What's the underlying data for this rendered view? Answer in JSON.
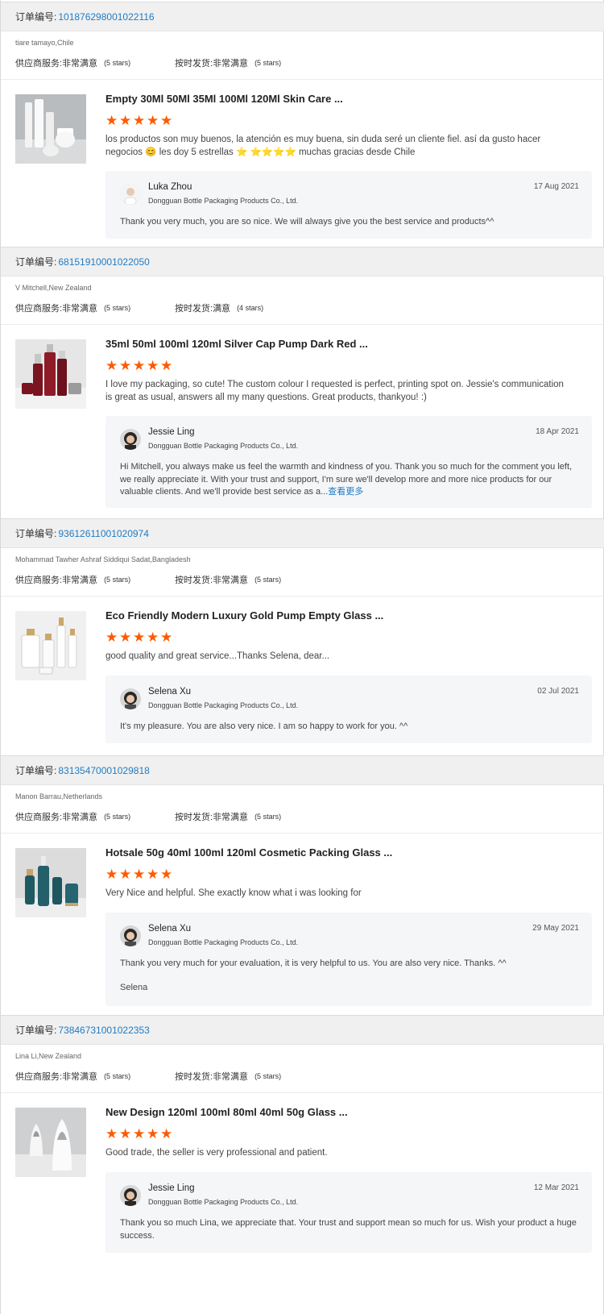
{
  "reviews": [
    {
      "order_label": "订单编号:",
      "order_no": "10187629800102211​6",
      "buyer": "tiare tamayo,Chile",
      "service_label": "供应商服务:",
      "service_value": "非常满意",
      "service_stars": "(5 stars)",
      "ship_label": "按时发货:",
      "ship_value": "非常满意",
      "ship_stars": "(5 stars)",
      "title": "Empty 30Ml 50Ml 35Ml 100Ml 120Ml Skin Care ...",
      "rating": 5,
      "comment": "los productos son muy buenos, la atención es muy buena, sin duda seré un cliente fiel. así da gusto hacer negocios 😊 les doy 5 estrellas ⭐ ⭐⭐⭐⭐ muchas gracias desde Chile",
      "reply_name": "Luka Zhou",
      "reply_company": "Dongguan Bottle Packaging Products Co., Ltd.",
      "reply_date": "17 Aug 2021",
      "reply_text": "Thank you very much,  you are so nice. We will always give you the best service and products^^",
      "reply_more": "",
      "reply_sig": ""
    },
    {
      "order_label": "订单编号:",
      "order_no": "68151910001022050",
      "buyer": "V Mitchell,New Zealand",
      "service_label": "供应商服务:",
      "service_value": "非常满意",
      "service_stars": "(5 stars)",
      "ship_label": "按时发货:",
      "ship_value": "满意",
      "ship_stars": "(4 stars)",
      "title": "35ml 50ml 100ml 120ml Silver Cap Pump Dark Red ...",
      "rating": 5,
      "comment": "I love my packaging, so cute! The custom colour I requested is perfect, printing spot on. Jessie's communication is great as usual, answers all my many questions. Great products, thankyou! :)",
      "reply_name": "Jessie Ling",
      "reply_company": "Dongguan Bottle Packaging Products Co., Ltd.",
      "reply_date": "18 Apr 2021",
      "reply_text": "Hi Mitchell, you always make us feel the warmth and kindness of you. Thank you so much for the comment you left, we really appreciate it. With your trust and support, I'm sure we'll develop more and more nice products for our valuable clients. And we'll  provide best service as a...",
      "reply_more": "查看更多",
      "reply_sig": ""
    },
    {
      "order_label": "订单编号:",
      "order_no": "93612611001020974",
      "buyer": "Mohammad Tawher Ashraf Siddiqui Sadat,Bangladesh",
      "service_label": "供应商服务:",
      "service_value": "非常满意",
      "service_stars": "(5 stars)",
      "ship_label": "按时发货:",
      "ship_value": "非常满意",
      "ship_stars": "(5 stars)",
      "title": "Eco Friendly Modern Luxury Gold Pump Empty Glass ...",
      "rating": 5,
      "comment": "good quality and great service...Thanks Selena, dear...",
      "reply_name": "Selena Xu",
      "reply_company": "Dongguan Bottle Packaging Products Co., Ltd.",
      "reply_date": "02 Jul 2021",
      "reply_text": "It's my pleasure. You are also very nice. I am so happy to work for you. ^^",
      "reply_more": "",
      "reply_sig": ""
    },
    {
      "order_label": "订单编号:",
      "order_no": "83135470001029818",
      "buyer": "Manon Barrau,Netherlands",
      "service_label": "供应商服务:",
      "service_value": "非常满意",
      "service_stars": "(5 stars)",
      "ship_label": "按时发货:",
      "ship_value": "非常满意",
      "ship_stars": "(5 stars)",
      "title": "Hotsale 50g 40ml 100ml 120ml Cosmetic Packing Glass ...",
      "rating": 5,
      "comment": "Very Nice and helpful. She exactly know what i was looking for",
      "reply_name": "Selena Xu",
      "reply_company": "Dongguan Bottle Packaging Products Co., Ltd.",
      "reply_date": "29 May 2021",
      "reply_text": "Thank you very much for your evaluation, it is very helpful to us. You are also very nice. Thanks. ^^",
      "reply_more": "",
      "reply_sig": "Selena"
    },
    {
      "order_label": "订单编号:",
      "order_no": "73846731001022353",
      "buyer": "Lina Li,New Zealand",
      "service_label": "供应商服务:",
      "service_value": "非常满意",
      "service_stars": "(5 stars)",
      "ship_label": "按时发货:",
      "ship_value": "非常满意",
      "ship_stars": "(5 stars)",
      "title": "New Design 120ml 100ml 80ml 40ml 50g Glass ...",
      "rating": 5,
      "comment": "Good trade, the seller is very professional and patient.",
      "reply_name": "Jessie Ling",
      "reply_company": "Dongguan Bottle Packaging Products Co., Ltd.",
      "reply_date": "12 Mar 2021",
      "reply_text": "Thank you so much Lina, we appreciate that. Your trust and support mean so much for us. Wish your product a huge success.",
      "reply_more": "",
      "reply_sig": ""
    }
  ],
  "colors": {
    "star": "#ff5a00",
    "link": "#1f7bc4",
    "order_bar": "#f0f0f0",
    "reply_bg": "#f5f6f8"
  },
  "icons": {
    "star": "star-icon"
  }
}
